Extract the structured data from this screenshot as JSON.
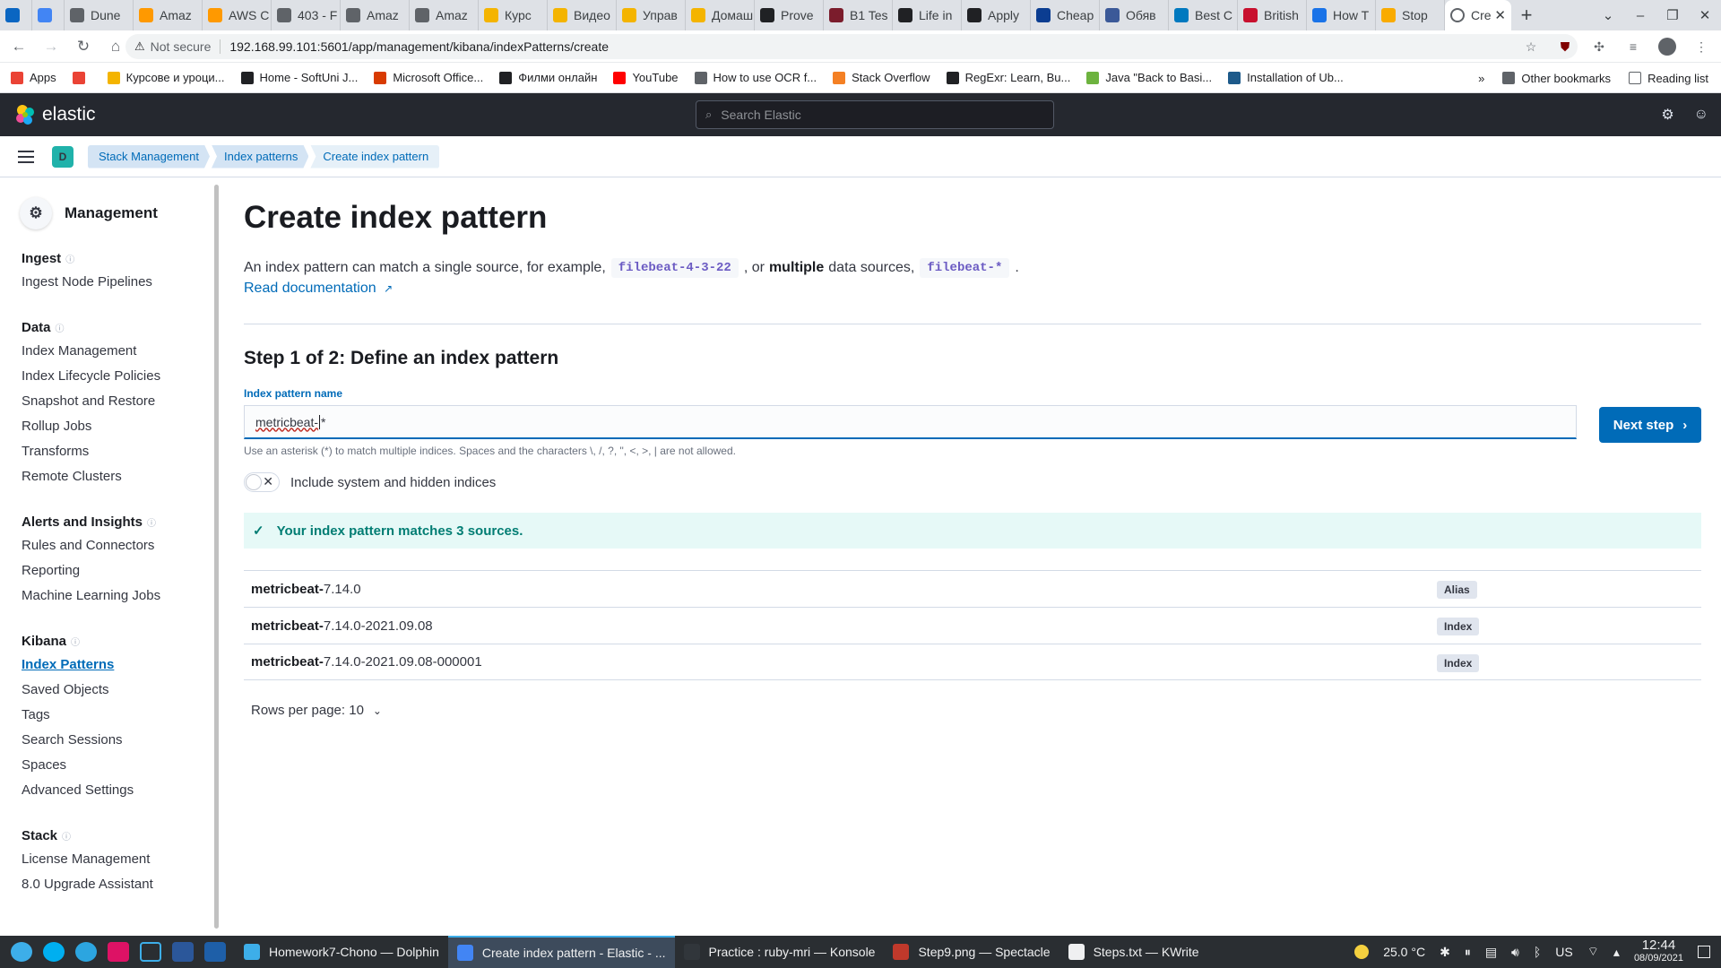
{
  "browser": {
    "tabs": [
      {
        "label": "",
        "color": "#0a66c2"
      },
      {
        "label": "",
        "color": "#4285f4"
      },
      {
        "label": "Dune",
        "color": "#5f6368"
      },
      {
        "label": "Amaz",
        "color": "#ff9900"
      },
      {
        "label": "AWS C",
        "color": "#ff9900"
      },
      {
        "label": "403 - F",
        "color": "#5f6368"
      },
      {
        "label": "Amaz",
        "color": "#5f6368"
      },
      {
        "label": "Amaz",
        "color": "#5f6368"
      },
      {
        "label": "Курс",
        "color": "#f4b400"
      },
      {
        "label": "Видео",
        "color": "#f4b400"
      },
      {
        "label": "Управ",
        "color": "#f4b400"
      },
      {
        "label": "Домаш",
        "color": "#f4b400"
      },
      {
        "label": "Prove",
        "color": "#202124"
      },
      {
        "label": "B1 Tes",
        "color": "#7b1c2c"
      },
      {
        "label": "Life in",
        "color": "#202124"
      },
      {
        "label": "Apply",
        "color": "#202124"
      },
      {
        "label": "Cheap",
        "color": "#0b3d91"
      },
      {
        "label": "Обяв",
        "color": "#3b5998"
      },
      {
        "label": "Best C",
        "color": "#0079bf"
      },
      {
        "label": "British",
        "color": "#c8102e"
      },
      {
        "label": "How T",
        "color": "#1a73e8"
      },
      {
        "label": "Stop",
        "color": "#f9ab00"
      }
    ],
    "active_tab": {
      "label": "Cre"
    },
    "url_security": "Not secure",
    "url": "192.168.99.101:5601/app/management/kibana/indexPatterns/create",
    "bookmarks": [
      {
        "label": "Apps",
        "color": "#ea4335"
      },
      {
        "label": "",
        "color": "#ea4335"
      },
      {
        "label": "Курсове и уроци...",
        "color": "#f4b400"
      },
      {
        "label": "Home - SoftUni J...",
        "color": "#202124"
      },
      {
        "label": "Microsoft Office...",
        "color": "#d83b01"
      },
      {
        "label": "Филми онлайн",
        "color": "#202124"
      },
      {
        "label": "YouTube",
        "color": "#ff0000"
      },
      {
        "label": "How to use OCR f...",
        "color": "#5f6368"
      },
      {
        "label": "Stack Overflow",
        "color": "#f48024"
      },
      {
        "label": "RegExr: Learn, Bu...",
        "color": "#202124"
      },
      {
        "label": "Java \"Back to Basi...",
        "color": "#6db33f"
      },
      {
        "label": "Installation of Ub...",
        "color": "#1d5a8a"
      }
    ],
    "other_bookmarks": "Other bookmarks",
    "reading_list": "Reading list"
  },
  "kibana": {
    "brand": "elastic",
    "search_placeholder": "Search Elastic",
    "space_initial": "D",
    "breadcrumbs": [
      "Stack Management",
      "Index patterns",
      "Create index pattern"
    ]
  },
  "sidebar": {
    "title": "Management",
    "sections": [
      {
        "title": "Ingest",
        "items": [
          "Ingest Node Pipelines"
        ]
      },
      {
        "title": "Data",
        "items": [
          "Index Management",
          "Index Lifecycle Policies",
          "Snapshot and Restore",
          "Rollup Jobs",
          "Transforms",
          "Remote Clusters"
        ]
      },
      {
        "title": "Alerts and Insights",
        "items": [
          "Rules and Connectors",
          "Reporting",
          "Machine Learning Jobs"
        ]
      },
      {
        "title": "Kibana",
        "items": [
          "Index Patterns",
          "Saved Objects",
          "Tags",
          "Search Sessions",
          "Spaces",
          "Advanced Settings"
        ]
      },
      {
        "title": "Stack",
        "items": [
          "License Management",
          "8.0 Upgrade Assistant"
        ]
      }
    ],
    "selected": "Index Patterns"
  },
  "main": {
    "title": "Create index pattern",
    "desc_1": "An index pattern can match a single source, for example,",
    "code_1": "filebeat-4-3-22",
    "desc_2": ", or",
    "desc_bold": "multiple",
    "desc_3": "data sources,",
    "code_2": "filebeat-*",
    "desc_4": ".",
    "read_doc": "Read documentation",
    "step_title": "Step 1 of 2: Define an index pattern",
    "field_label": "Index pattern name",
    "input_value_a": "metricbeat-",
    "input_value_b": "*",
    "help_text": "Use an asterisk (*) to match multiple indices. Spaces and the characters \\, /, ?, \", <, >, | are not allowed.",
    "next_button": "Next step",
    "toggle_label": "Include system and hidden indices",
    "callout": "Your index pattern matches 3 sources.",
    "rows": [
      {
        "bold": "metricbeat-",
        "rest": "7.14.0",
        "badge": "Alias"
      },
      {
        "bold": "metricbeat-",
        "rest": "7.14.0-2021.09.08",
        "badge": "Index"
      },
      {
        "bold": "metricbeat-",
        "rest": "7.14.0-2021.09.08-000001",
        "badge": "Index"
      }
    ],
    "rows_per_page": "Rows per page: 10"
  },
  "taskbar": {
    "tasks": [
      {
        "label": "Homework7-Chono — Dolphin",
        "color": "#3daee9"
      },
      {
        "label": "Create index pattern - Elastic - ...",
        "color": "#4285f4"
      },
      {
        "label": "Practice : ruby-mri — Konsole",
        "color": "#31363b"
      },
      {
        "label": "Step9.png — Spectacle",
        "color": "#c0392b"
      },
      {
        "label": "Steps.txt — KWrite",
        "color": "#eff0f1"
      }
    ],
    "weather": "25.0 °C",
    "keyboard": "US",
    "time": "12:44",
    "date": "08/09/2021"
  }
}
